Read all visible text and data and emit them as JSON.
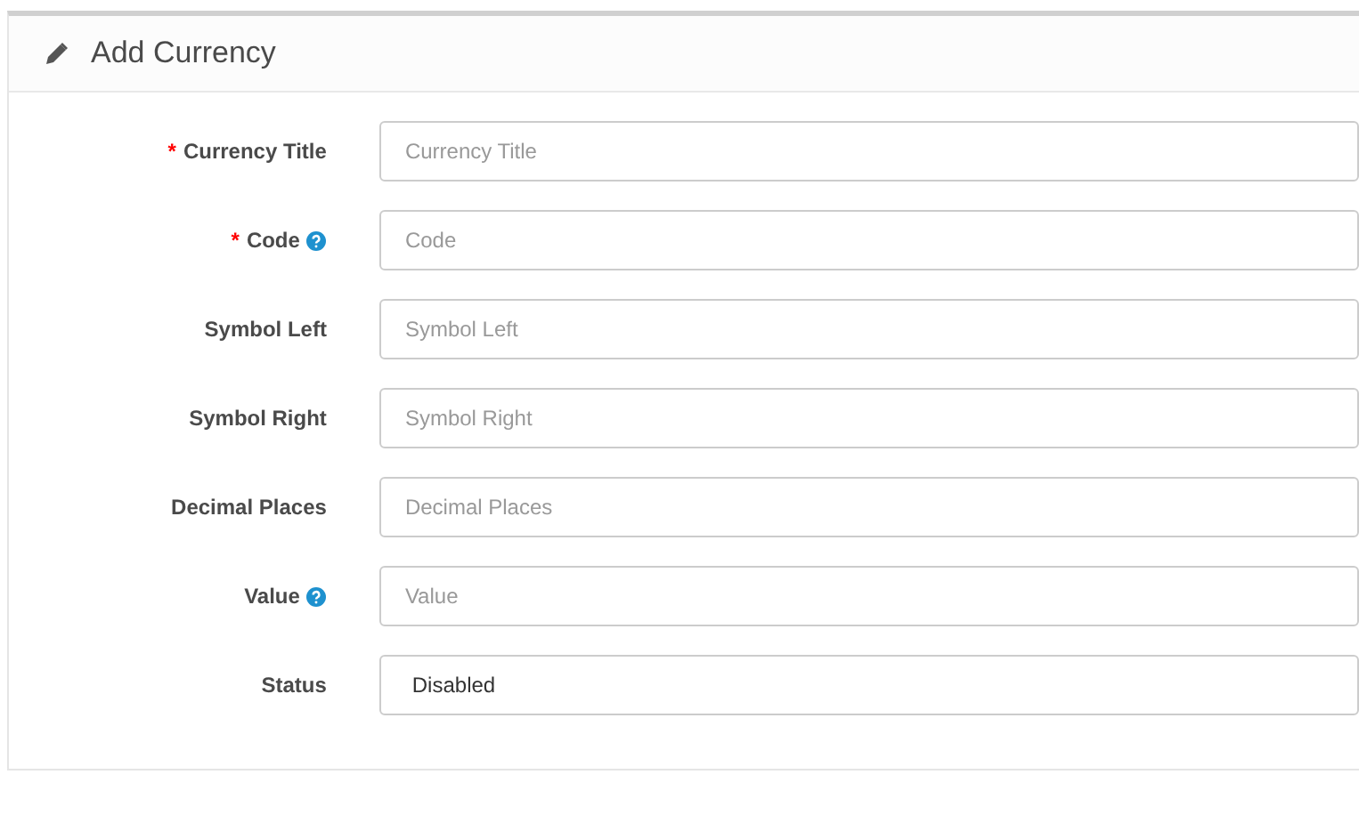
{
  "panel": {
    "title": "Add Currency"
  },
  "required_mark": "*",
  "fields": [
    {
      "label": "Currency Title",
      "required": true,
      "help": false,
      "kind": "text",
      "placeholder": "Currency Title"
    },
    {
      "label": "Code",
      "required": true,
      "help": true,
      "kind": "text",
      "placeholder": "Code"
    },
    {
      "label": "Symbol Left",
      "required": false,
      "help": false,
      "kind": "text",
      "placeholder": "Symbol Left"
    },
    {
      "label": "Symbol Right",
      "required": false,
      "help": false,
      "kind": "text",
      "placeholder": "Symbol Right"
    },
    {
      "label": "Decimal Places",
      "required": false,
      "help": false,
      "kind": "text",
      "placeholder": "Decimal Places"
    },
    {
      "label": "Value",
      "required": false,
      "help": true,
      "kind": "text",
      "placeholder": "Value"
    },
    {
      "label": "Status",
      "required": false,
      "help": false,
      "kind": "select",
      "value": "Disabled"
    }
  ]
}
